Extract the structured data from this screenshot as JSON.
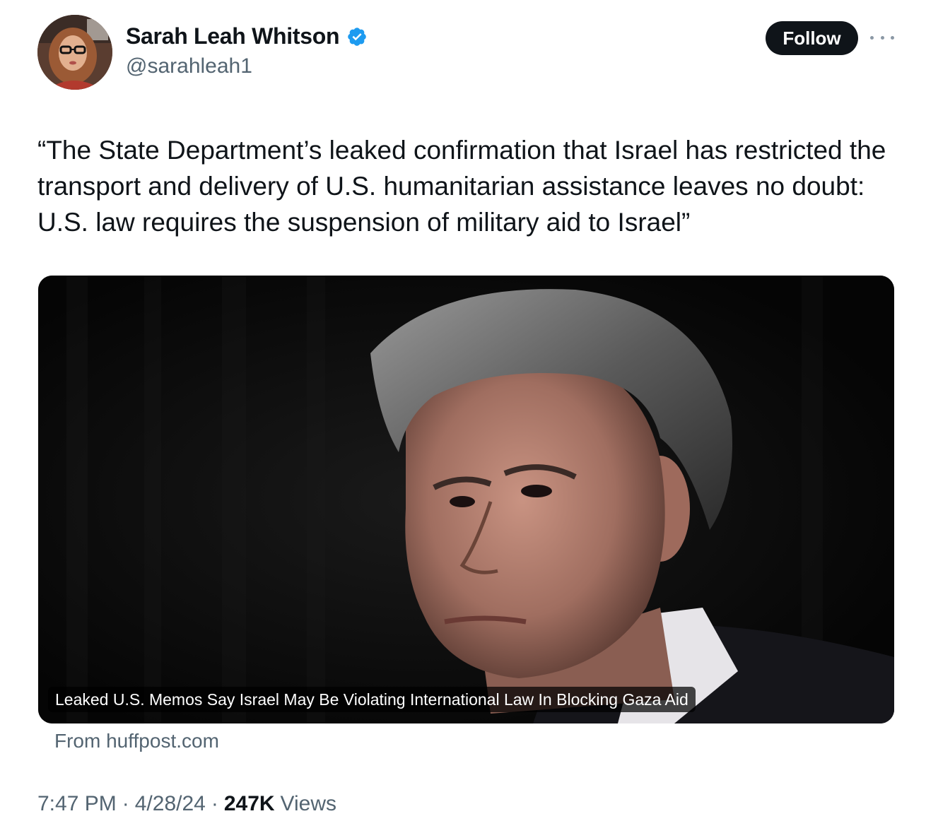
{
  "author": {
    "display_name": "Sarah Leah Whitson",
    "handle": "@sarahleah1",
    "verified": true
  },
  "actions": {
    "follow_label": "Follow"
  },
  "tweet": {
    "text": "“The State Department’s leaked confirmation that Israel has restricted the transport and delivery of U.S. humanitarian assistance leaves no doubt: U.S. law requires the suspension of military aid to Israel”"
  },
  "card": {
    "caption": "Leaked U.S. Memos Say Israel May Be Violating International Law In Blocking Gaza Aid",
    "source": "From huffpost.com"
  },
  "meta": {
    "time": "7:47 PM",
    "date": "4/28/24",
    "separator": "·",
    "views_count": "247K",
    "views_label": "Views"
  },
  "colors": {
    "text_primary": "#0f1419",
    "text_secondary": "#536471",
    "verified_blue": "#1d9bf0",
    "follow_bg": "#0f1419"
  },
  "icons": {
    "verified": "verified-badge-icon",
    "more": "more-dots-icon"
  }
}
